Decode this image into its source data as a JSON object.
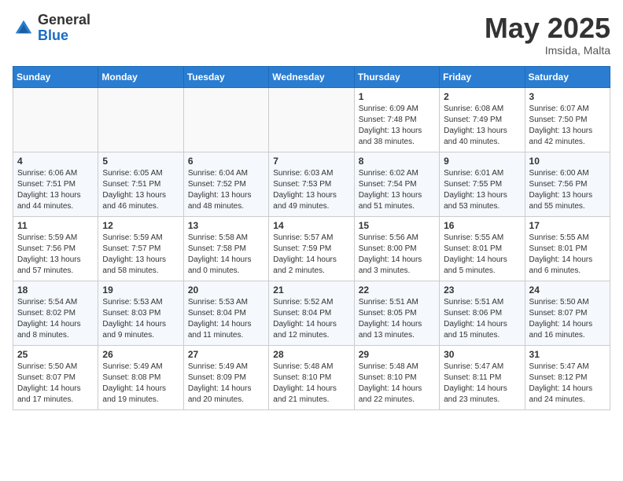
{
  "logo": {
    "general": "General",
    "blue": "Blue"
  },
  "header": {
    "month": "May 2025",
    "location": "Imsida, Malta"
  },
  "weekdays": [
    "Sunday",
    "Monday",
    "Tuesday",
    "Wednesday",
    "Thursday",
    "Friday",
    "Saturday"
  ],
  "weeks": [
    [
      {
        "day": "",
        "info": ""
      },
      {
        "day": "",
        "info": ""
      },
      {
        "day": "",
        "info": ""
      },
      {
        "day": "",
        "info": ""
      },
      {
        "day": "1",
        "info": "Sunrise: 6:09 AM\nSunset: 7:48 PM\nDaylight: 13 hours\nand 38 minutes."
      },
      {
        "day": "2",
        "info": "Sunrise: 6:08 AM\nSunset: 7:49 PM\nDaylight: 13 hours\nand 40 minutes."
      },
      {
        "day": "3",
        "info": "Sunrise: 6:07 AM\nSunset: 7:50 PM\nDaylight: 13 hours\nand 42 minutes."
      }
    ],
    [
      {
        "day": "4",
        "info": "Sunrise: 6:06 AM\nSunset: 7:51 PM\nDaylight: 13 hours\nand 44 minutes."
      },
      {
        "day": "5",
        "info": "Sunrise: 6:05 AM\nSunset: 7:51 PM\nDaylight: 13 hours\nand 46 minutes."
      },
      {
        "day": "6",
        "info": "Sunrise: 6:04 AM\nSunset: 7:52 PM\nDaylight: 13 hours\nand 48 minutes."
      },
      {
        "day": "7",
        "info": "Sunrise: 6:03 AM\nSunset: 7:53 PM\nDaylight: 13 hours\nand 49 minutes."
      },
      {
        "day": "8",
        "info": "Sunrise: 6:02 AM\nSunset: 7:54 PM\nDaylight: 13 hours\nand 51 minutes."
      },
      {
        "day": "9",
        "info": "Sunrise: 6:01 AM\nSunset: 7:55 PM\nDaylight: 13 hours\nand 53 minutes."
      },
      {
        "day": "10",
        "info": "Sunrise: 6:00 AM\nSunset: 7:56 PM\nDaylight: 13 hours\nand 55 minutes."
      }
    ],
    [
      {
        "day": "11",
        "info": "Sunrise: 5:59 AM\nSunset: 7:56 PM\nDaylight: 13 hours\nand 57 minutes."
      },
      {
        "day": "12",
        "info": "Sunrise: 5:59 AM\nSunset: 7:57 PM\nDaylight: 13 hours\nand 58 minutes."
      },
      {
        "day": "13",
        "info": "Sunrise: 5:58 AM\nSunset: 7:58 PM\nDaylight: 14 hours\nand 0 minutes."
      },
      {
        "day": "14",
        "info": "Sunrise: 5:57 AM\nSunset: 7:59 PM\nDaylight: 14 hours\nand 2 minutes."
      },
      {
        "day": "15",
        "info": "Sunrise: 5:56 AM\nSunset: 8:00 PM\nDaylight: 14 hours\nand 3 minutes."
      },
      {
        "day": "16",
        "info": "Sunrise: 5:55 AM\nSunset: 8:01 PM\nDaylight: 14 hours\nand 5 minutes."
      },
      {
        "day": "17",
        "info": "Sunrise: 5:55 AM\nSunset: 8:01 PM\nDaylight: 14 hours\nand 6 minutes."
      }
    ],
    [
      {
        "day": "18",
        "info": "Sunrise: 5:54 AM\nSunset: 8:02 PM\nDaylight: 14 hours\nand 8 minutes."
      },
      {
        "day": "19",
        "info": "Sunrise: 5:53 AM\nSunset: 8:03 PM\nDaylight: 14 hours\nand 9 minutes."
      },
      {
        "day": "20",
        "info": "Sunrise: 5:53 AM\nSunset: 8:04 PM\nDaylight: 14 hours\nand 11 minutes."
      },
      {
        "day": "21",
        "info": "Sunrise: 5:52 AM\nSunset: 8:04 PM\nDaylight: 14 hours\nand 12 minutes."
      },
      {
        "day": "22",
        "info": "Sunrise: 5:51 AM\nSunset: 8:05 PM\nDaylight: 14 hours\nand 13 minutes."
      },
      {
        "day": "23",
        "info": "Sunrise: 5:51 AM\nSunset: 8:06 PM\nDaylight: 14 hours\nand 15 minutes."
      },
      {
        "day": "24",
        "info": "Sunrise: 5:50 AM\nSunset: 8:07 PM\nDaylight: 14 hours\nand 16 minutes."
      }
    ],
    [
      {
        "day": "25",
        "info": "Sunrise: 5:50 AM\nSunset: 8:07 PM\nDaylight: 14 hours\nand 17 minutes."
      },
      {
        "day": "26",
        "info": "Sunrise: 5:49 AM\nSunset: 8:08 PM\nDaylight: 14 hours\nand 19 minutes."
      },
      {
        "day": "27",
        "info": "Sunrise: 5:49 AM\nSunset: 8:09 PM\nDaylight: 14 hours\nand 20 minutes."
      },
      {
        "day": "28",
        "info": "Sunrise: 5:48 AM\nSunset: 8:10 PM\nDaylight: 14 hours\nand 21 minutes."
      },
      {
        "day": "29",
        "info": "Sunrise: 5:48 AM\nSunset: 8:10 PM\nDaylight: 14 hours\nand 22 minutes."
      },
      {
        "day": "30",
        "info": "Sunrise: 5:47 AM\nSunset: 8:11 PM\nDaylight: 14 hours\nand 23 minutes."
      },
      {
        "day": "31",
        "info": "Sunrise: 5:47 AM\nSunset: 8:12 PM\nDaylight: 14 hours\nand 24 minutes."
      }
    ]
  ]
}
